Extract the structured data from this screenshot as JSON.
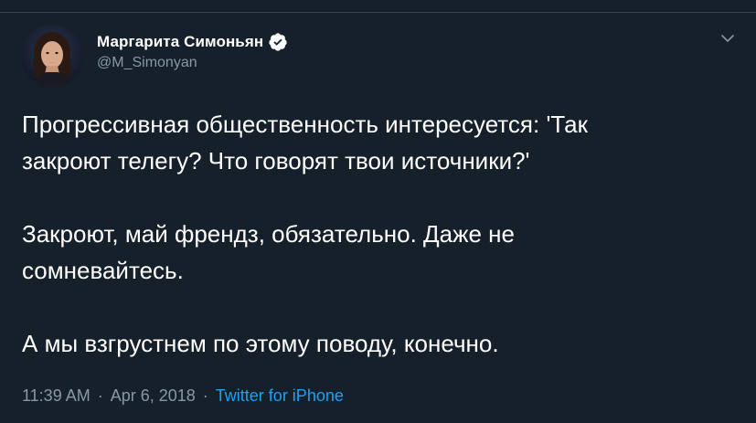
{
  "tweet": {
    "author": {
      "display_name": "Маргарита Симоньян",
      "handle": "@M_Simonyan",
      "verified": true
    },
    "text_paragraphs": [
      [
        "Прогрессивная общественность интересуется: 'Так",
        "закроют телегу? Что говорят твои источники?'"
      ],
      [
        "Закроют, май френдз, обязательно. Даже не",
        "сомневайтесь."
      ],
      [
        "А мы взгрустнем по этому поводу, конечно."
      ]
    ],
    "meta": {
      "time": "11:39 AM",
      "separator": "·",
      "date": "Apr 6, 2018",
      "source": "Twitter for iPhone"
    }
  },
  "icons": {
    "verified": "verified-badge-icon",
    "more": "chevron-down-icon"
  },
  "colors": {
    "background": "#15202b",
    "text": "#ffffff",
    "muted": "#8899a6",
    "accent": "#1da1f2",
    "divider": "#38444d"
  }
}
